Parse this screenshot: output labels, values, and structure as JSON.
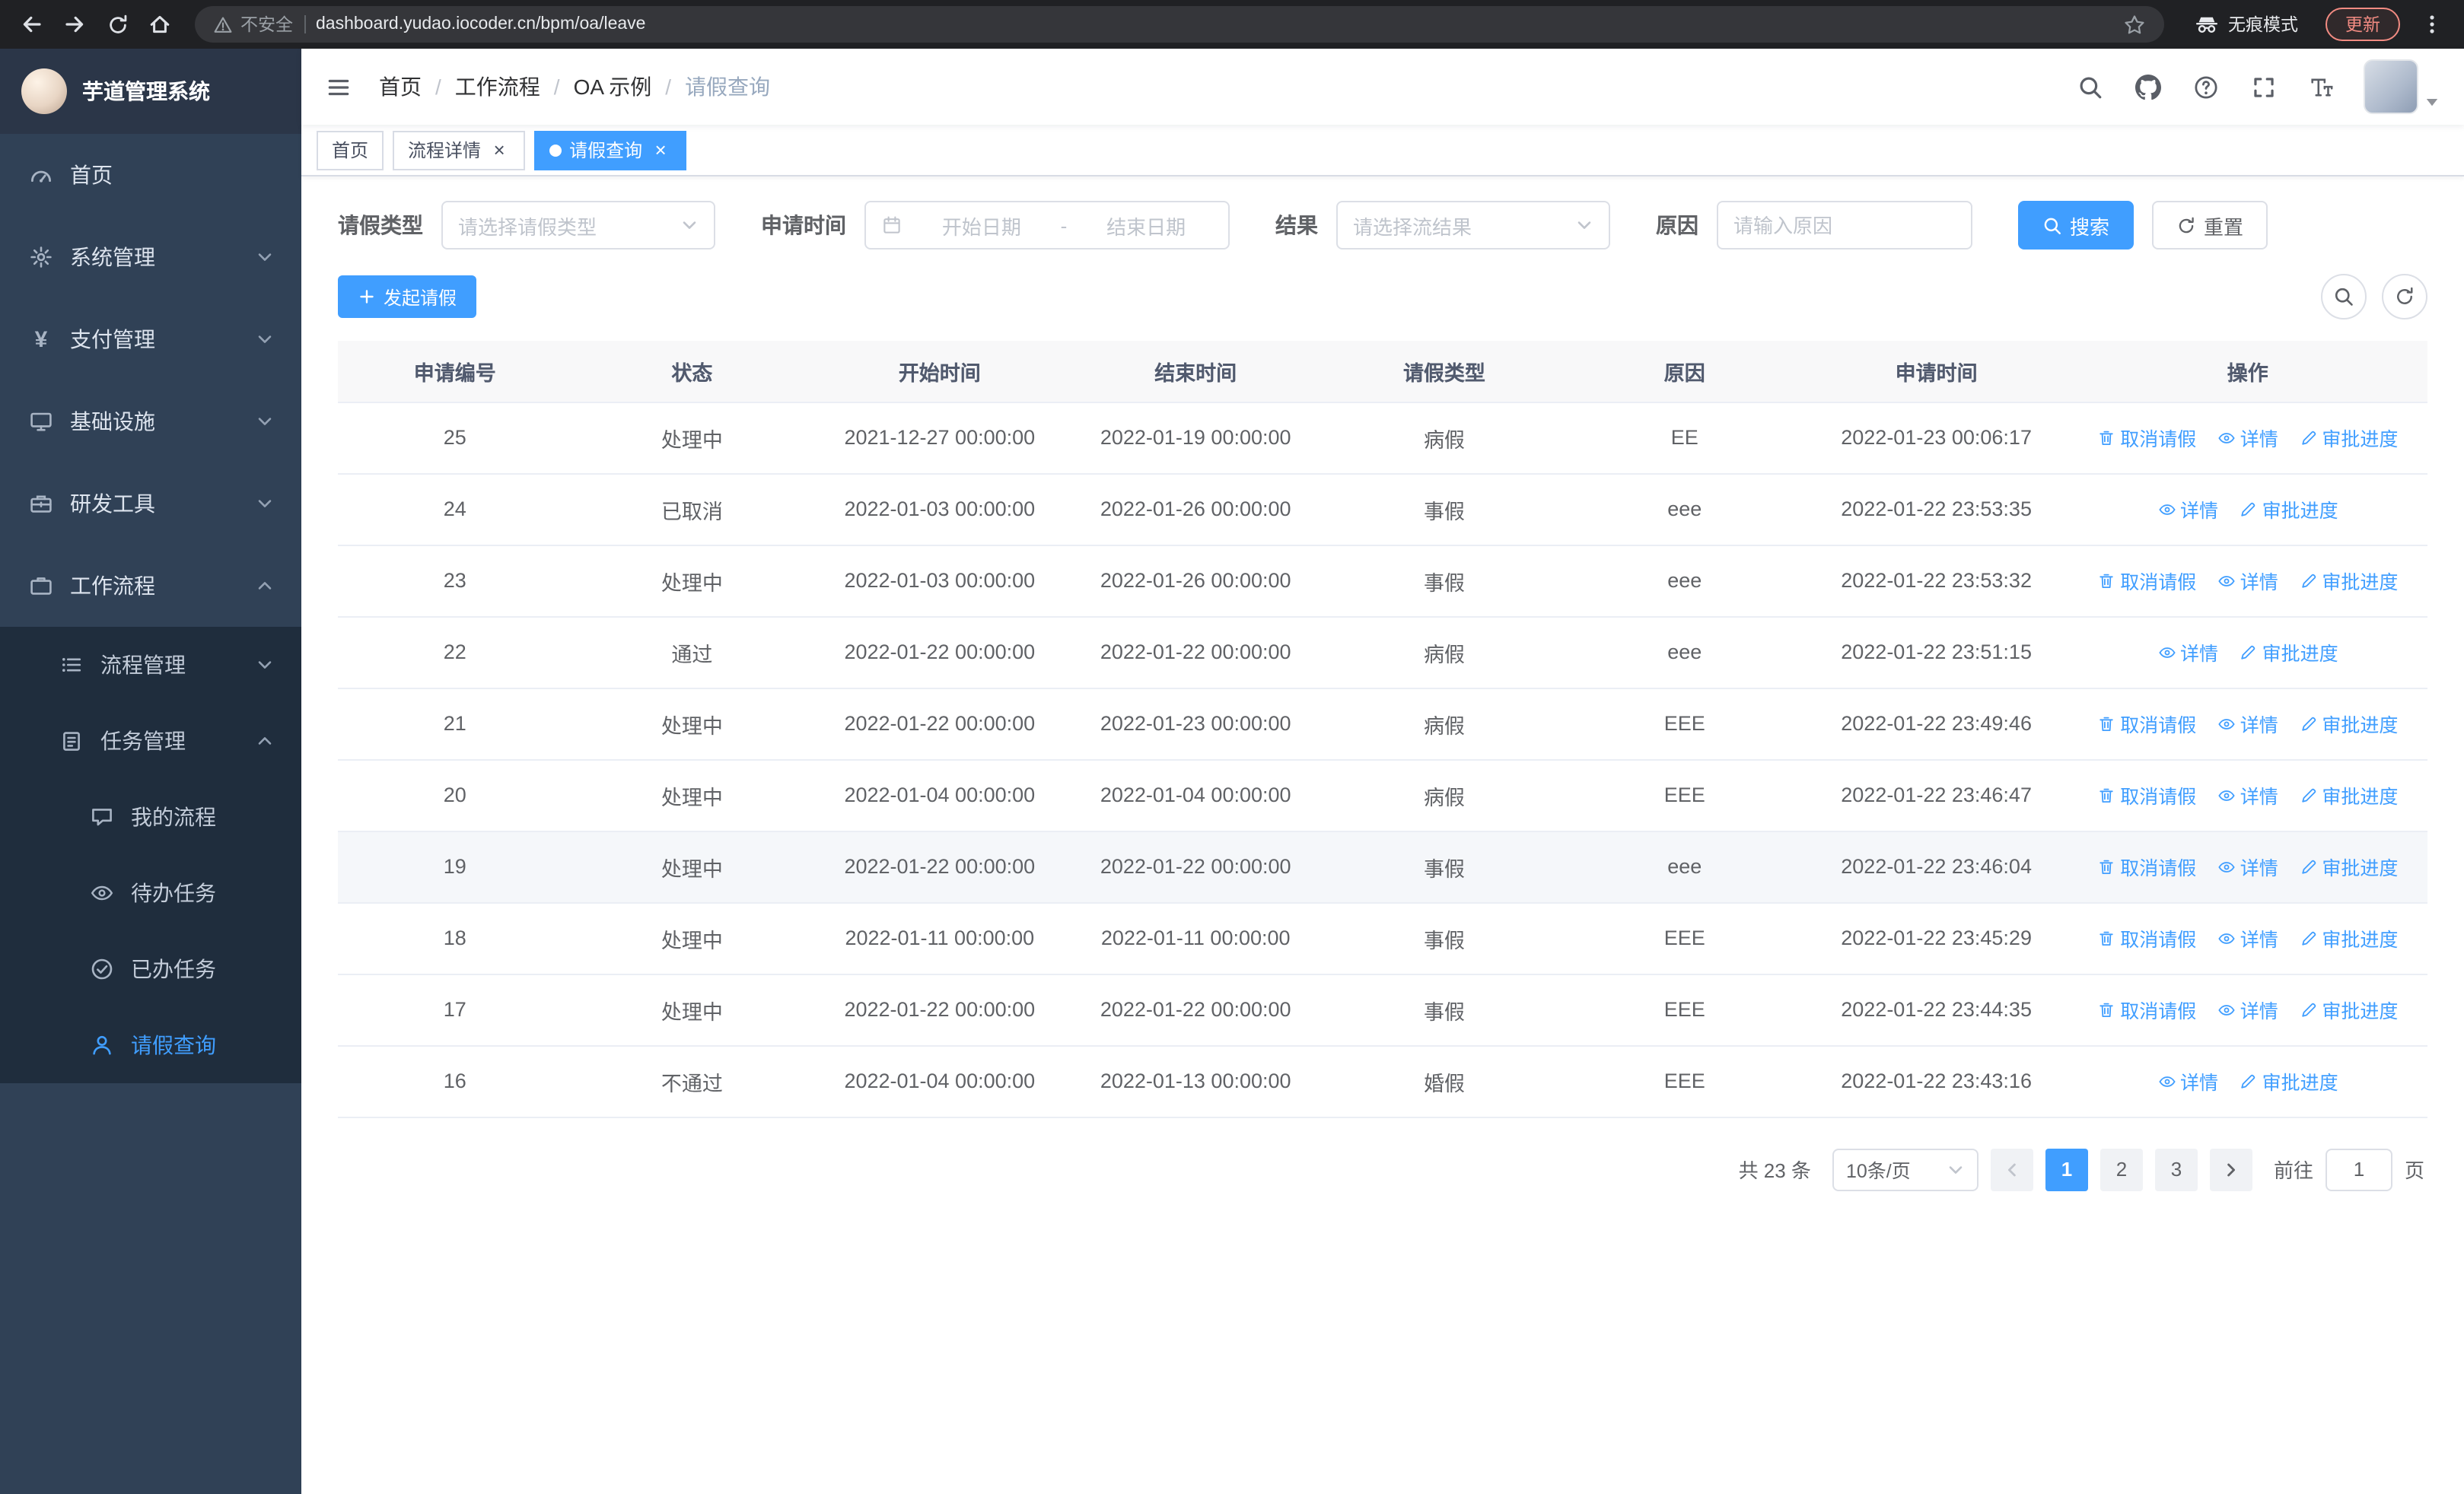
{
  "colors": {
    "accent": "#409eff",
    "sidebar_bg": "#304156",
    "sidebar_submenu_bg": "#1f2d3d",
    "chrome_bg": "#202124",
    "table_header_bg": "#f8f8f9"
  },
  "icons": {
    "close": "×",
    "yen": "¥"
  },
  "browser": {
    "security_label": "不安全",
    "url": "dashboard.yudao.iocoder.cn/bpm/oa/leave",
    "incognito_label": "无痕模式",
    "update_label": "更新"
  },
  "sidebar": {
    "logo_title": "芋道管理系统",
    "items": [
      {
        "label": "首页"
      },
      {
        "label": "系统管理"
      },
      {
        "label": "支付管理"
      },
      {
        "label": "基础设施"
      },
      {
        "label": "研发工具"
      },
      {
        "label": "工作流程"
      },
      {
        "label": "流程管理"
      },
      {
        "label": "任务管理"
      },
      {
        "label": "我的流程"
      },
      {
        "label": "待办任务"
      },
      {
        "label": "已办任务"
      },
      {
        "label": "请假查询"
      }
    ]
  },
  "breadcrumb": {
    "separator": "/",
    "items": [
      "首页",
      "工作流程",
      "OA 示例",
      "请假查询"
    ]
  },
  "tabs": [
    {
      "label": "首页"
    },
    {
      "label": "流程详情"
    },
    {
      "label": "请假查询"
    }
  ],
  "filters": {
    "leave_type_label": "请假类型",
    "leave_type_placeholder": "请选择请假类型",
    "apply_time_label": "申请时间",
    "start_date_placeholder": "开始日期",
    "range_separator": "-",
    "end_date_placeholder": "结束日期",
    "result_label": "结果",
    "result_placeholder": "请选择流结果",
    "reason_label": "原因",
    "reason_placeholder": "请输入原因",
    "search_label": "搜索",
    "reset_label": "重置"
  },
  "toolbar": {
    "create_label": "发起请假"
  },
  "table": {
    "headers": [
      "申请编号",
      "状态",
      "开始时间",
      "结束时间",
      "请假类型",
      "原因",
      "申请时间",
      "操作"
    ],
    "action_labels": {
      "cancel": "取消请假",
      "detail": "详情",
      "progress": "审批进度"
    },
    "rows": [
      {
        "id": "25",
        "status": "处理中",
        "start": "2021-12-27 00:00:00",
        "end": "2022-01-19 00:00:00",
        "type": "病假",
        "reason": "EE",
        "applied": "2022-01-23 00:06:17",
        "actions": [
          "cancel",
          "detail",
          "progress"
        ]
      },
      {
        "id": "24",
        "status": "已取消",
        "start": "2022-01-03 00:00:00",
        "end": "2022-01-26 00:00:00",
        "type": "事假",
        "reason": "eee",
        "applied": "2022-01-22 23:53:35",
        "actions": [
          "detail",
          "progress"
        ]
      },
      {
        "id": "23",
        "status": "处理中",
        "start": "2022-01-03 00:00:00",
        "end": "2022-01-26 00:00:00",
        "type": "事假",
        "reason": "eee",
        "applied": "2022-01-22 23:53:32",
        "actions": [
          "cancel",
          "detail",
          "progress"
        ]
      },
      {
        "id": "22",
        "status": "通过",
        "start": "2022-01-22 00:00:00",
        "end": "2022-01-22 00:00:00",
        "type": "病假",
        "reason": "eee",
        "applied": "2022-01-22 23:51:15",
        "actions": [
          "detail",
          "progress"
        ]
      },
      {
        "id": "21",
        "status": "处理中",
        "start": "2022-01-22 00:00:00",
        "end": "2022-01-23 00:00:00",
        "type": "病假",
        "reason": "EEE",
        "applied": "2022-01-22 23:49:46",
        "actions": [
          "cancel",
          "detail",
          "progress"
        ]
      },
      {
        "id": "20",
        "status": "处理中",
        "start": "2022-01-04 00:00:00",
        "end": "2022-01-04 00:00:00",
        "type": "病假",
        "reason": "EEE",
        "applied": "2022-01-22 23:46:47",
        "actions": [
          "cancel",
          "detail",
          "progress"
        ]
      },
      {
        "id": "19",
        "status": "处理中",
        "start": "2022-01-22 00:00:00",
        "end": "2022-01-22 00:00:00",
        "type": "事假",
        "reason": "eee",
        "applied": "2022-01-22 23:46:04",
        "actions": [
          "cancel",
          "detail",
          "progress"
        ],
        "highlighted": true
      },
      {
        "id": "18",
        "status": "处理中",
        "start": "2022-01-11 00:00:00",
        "end": "2022-01-11 00:00:00",
        "type": "事假",
        "reason": "EEE",
        "applied": "2022-01-22 23:45:29",
        "actions": [
          "cancel",
          "detail",
          "progress"
        ]
      },
      {
        "id": "17",
        "status": "处理中",
        "start": "2022-01-22 00:00:00",
        "end": "2022-01-22 00:00:00",
        "type": "事假",
        "reason": "EEE",
        "applied": "2022-01-22 23:44:35",
        "actions": [
          "cancel",
          "detail",
          "progress"
        ]
      },
      {
        "id": "16",
        "status": "不通过",
        "start": "2022-01-04 00:00:00",
        "end": "2022-01-13 00:00:00",
        "type": "婚假",
        "reason": "EEE",
        "applied": "2022-01-22 23:43:16",
        "actions": [
          "detail",
          "progress"
        ]
      }
    ]
  },
  "pagination": {
    "total_label": "共 23 条",
    "page_size_label": "10条/页",
    "pages": [
      "1",
      "2",
      "3"
    ],
    "goto_label": "前往",
    "goto_value": "1",
    "page_unit_label": "页"
  }
}
